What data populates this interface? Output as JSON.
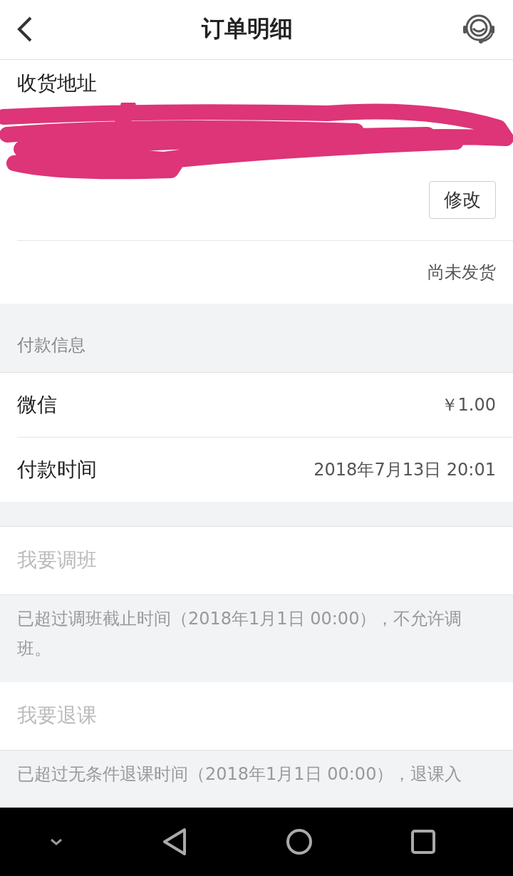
{
  "header": {
    "title": "订单明细"
  },
  "address": {
    "title": "收货地址",
    "edit_button": "修改",
    "status": "尚未发货"
  },
  "payment": {
    "section_label": "付款信息",
    "rows": [
      {
        "label": "微信",
        "value": "￥1.00"
      },
      {
        "label": "付款时间",
        "value": "2018年7月13日 20:01"
      }
    ]
  },
  "actions": [
    {
      "label": "我要调班",
      "disabled": true,
      "note": "已超过调班截止时间（2018年1月1日 00:00），不允许调班。"
    },
    {
      "label": "我要退课",
      "disabled": true,
      "note": "已超过无条件退课时间（2018年1月1日 00:00），退课入"
    }
  ]
}
